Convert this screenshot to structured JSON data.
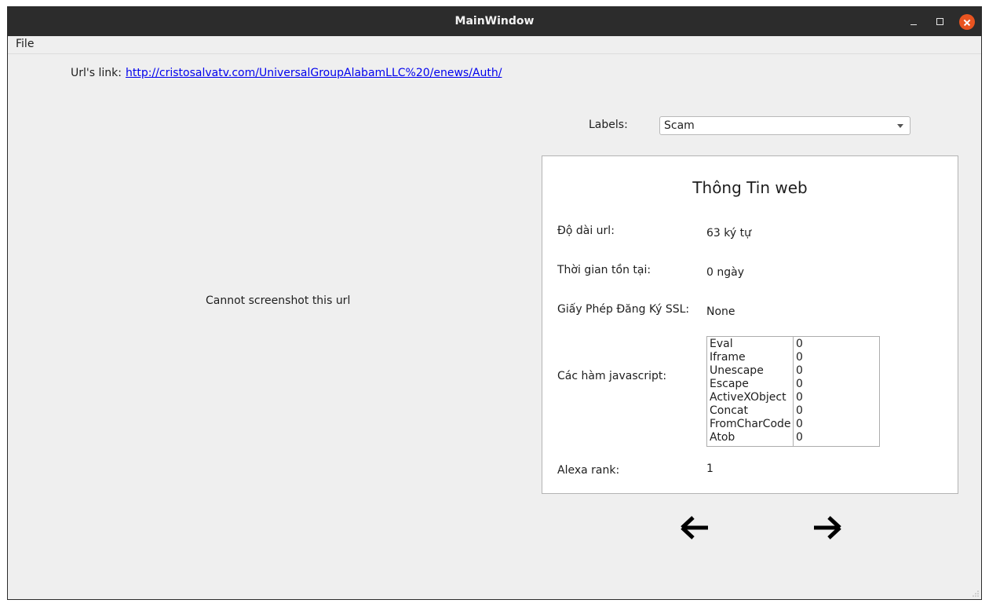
{
  "window": {
    "title": "MainWindow"
  },
  "menu": {
    "file": "File"
  },
  "url": {
    "label": "Url's link:",
    "link": "http://cristosalvatv.com/UniversalGroupAlabamLLC%20/enews/Auth/"
  },
  "screenshot": {
    "message": "Cannot screenshot this url"
  },
  "labels": {
    "label": "Labels:",
    "selected": "Scam"
  },
  "info": {
    "title": "Thông Tin web",
    "url_length_label": "Độ dài url:",
    "url_length_value": "63 ký tự",
    "age_label": "Thời gian tồn tại:",
    "age_value": "0 ngày",
    "ssl_label": "Giấy Phép Đăng Ký SSL:",
    "ssl_value": "None",
    "js_label": "Các hàm javascript:",
    "js_functions": [
      {
        "name": "Eval",
        "count": "0"
      },
      {
        "name": "Iframe",
        "count": "0"
      },
      {
        "name": "Unescape",
        "count": "0"
      },
      {
        "name": "Escape",
        "count": "0"
      },
      {
        "name": "ActiveXObject",
        "count": "0"
      },
      {
        "name": "Concat",
        "count": "0"
      },
      {
        "name": "FromCharCode",
        "count": "0"
      },
      {
        "name": "Atob",
        "count": "0"
      }
    ],
    "alexa_label": "Alexa rank:",
    "alexa_value": "1"
  },
  "icons": {
    "prev": "arrow-left-icon",
    "next": "arrow-right-icon",
    "close_color": "#e95420"
  }
}
